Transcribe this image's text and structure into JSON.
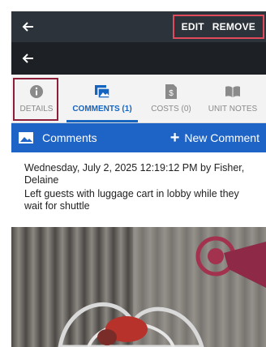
{
  "toolbar": {
    "edit_label": "EDIT",
    "remove_label": "REMOVE"
  },
  "tabs": [
    {
      "label": "DETAILS"
    },
    {
      "label": "COMMENTS (1)"
    },
    {
      "label": "COSTS (0)"
    },
    {
      "label": "UNIT NOTES"
    }
  ],
  "comments_bar": {
    "title": "Comments",
    "new_label": "New Comment"
  },
  "comment": {
    "header": "Wednesday, July 2, 2025 12:19:12 PM by Fisher, Delaine",
    "body": "Left guests with luggage cart in lobby while they wait for shuttle"
  },
  "colors": {
    "accent": "#1e63c6",
    "highlight": "#e04a5a",
    "topbar": "#2c333b"
  }
}
